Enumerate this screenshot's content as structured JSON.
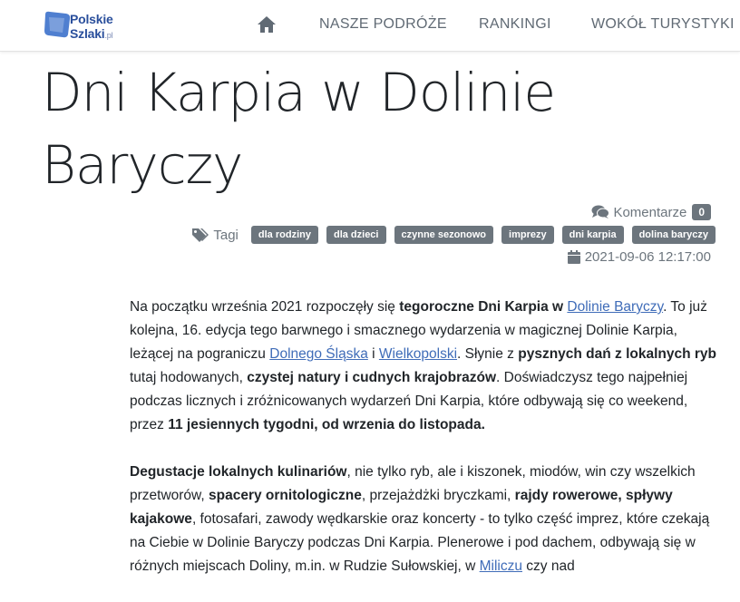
{
  "brand": {
    "line1": "Polskie",
    "line2": "Szlaki",
    "suffix": ".pl"
  },
  "nav": {
    "home_icon": "home-icon",
    "items": [
      "NASZE PODRÓŻE",
      "RANKINGI",
      "WOKÓŁ TURYSTYKI"
    ]
  },
  "article": {
    "title": "Dni Karpia w Dolinie Baryczy",
    "comments_label": "Komentarze",
    "comments_count": "0",
    "tags_label": "Tagi",
    "tags": [
      "dla rodziny",
      "dla dzieci",
      "czynne sezonowo",
      "imprezy",
      "dni karpia",
      "dolina baryczy"
    ],
    "date": "2021-09-06 12:17:00",
    "p1": {
      "t1": "Na początku września 2021 rozpoczęły się ",
      "b1": "tegoroczne Dni Karpia w ",
      "l1": "Dolinie Baryczy",
      "t2": ". To już kolejna, 16. edycja tego barwnego i smacznego wydarzenia w magicznej Dolinie Karpia, leżącej na pograniczu ",
      "l2": "Dolnego Śląska",
      "t3": " i ",
      "l3": "Wielkopolski",
      "t4": ". Słynie z ",
      "b2": "pysznych dań z lokalnych ryb",
      "t5": " tutaj hodowanych, ",
      "b3": "czystej natury i cudnych krajobrazów",
      "t6": ". Doświadczysz tego najpełniej podczas licznych i zróżnicowanych wydarzeń Dni Karpia, które odbywają się co weekend, przez ",
      "b4": "11 jesiennych tygodni, od wrzenia do listopada."
    },
    "p2": {
      "b1": "Degustacje lokalnych kulinariów",
      "t1": ", nie tylko ryb, ale i kiszonek, miodów, win czy wszelkich przetworów, ",
      "b2": "spacery ornitologiczne",
      "t2": ", przejażdżki bryczkami, ",
      "b3": "rajdy rowerowe, spływy kajakowe",
      "t3": ", fotosafari, zawody wędkarskie oraz koncerty - to tylko część imprez, które czekają na Ciebie w Dolinie Baryczy podczas Dni Karpia. Plenerowe i pod dachem, odbywają się w różnych miejscach Doliny, m.in. w Rudzie Sułowskiej, w ",
      "l1": "Miliczu",
      "t4": " czy nad"
    }
  },
  "colors": {
    "accent": "#3f6cb8",
    "badge": "#6c757d",
    "brand": "#2a4f9c"
  }
}
